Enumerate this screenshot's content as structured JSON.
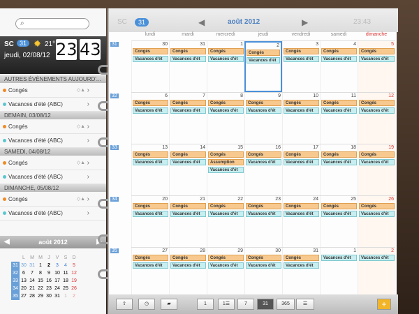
{
  "search": {
    "placeholder": ""
  },
  "header": {
    "city": "SC",
    "week": "31",
    "temp": "21°",
    "date": "jeudi, 02/08/12",
    "hour": "23",
    "minute": "43"
  },
  "sections": [
    {
      "title": "AUTRES ÉVÈNEMENTS AUJOURD'...",
      "events": [
        {
          "label": "Congés",
          "color": "#f08a24"
        },
        {
          "label": "Vacances d'été (ABC)",
          "color": "#5cc6d0"
        }
      ]
    },
    {
      "title": "DEMAIN, 03/08/12",
      "events": [
        {
          "label": "Congés",
          "color": "#f08a24"
        },
        {
          "label": "Vacances d'été (ABC)",
          "color": "#5cc6d0"
        }
      ]
    },
    {
      "title": "SAMEDI, 04/08/12",
      "events": [
        {
          "label": "Congés",
          "color": "#f08a24"
        },
        {
          "label": "Vacances d'été (ABC)",
          "color": "#5cc6d0"
        }
      ]
    },
    {
      "title": "DIMANCHE, 05/08/12",
      "events": [
        {
          "label": "Congés",
          "color": "#f08a24"
        },
        {
          "label": "Vacances d'été (ABC)",
          "color": "#5cc6d0"
        }
      ]
    }
  ],
  "mini": {
    "title": "août 2012",
    "headers": [
      "L",
      "M",
      "M",
      "J",
      "V",
      "S",
      "D"
    ],
    "weeks": [
      {
        "wn": "31",
        "days": [
          "30",
          "31",
          "1",
          "2",
          "3",
          "4",
          "5"
        ]
      },
      {
        "wn": "32",
        "days": [
          "6",
          "7",
          "8",
          "9",
          "10",
          "11",
          "12"
        ]
      },
      {
        "wn": "33",
        "days": [
          "13",
          "14",
          "15",
          "16",
          "17",
          "18",
          "19"
        ]
      },
      {
        "wn": "34",
        "days": [
          "20",
          "21",
          "22",
          "23",
          "24",
          "25",
          "26"
        ]
      },
      {
        "wn": "35",
        "days": [
          "27",
          "28",
          "29",
          "30",
          "31",
          "1",
          "2"
        ]
      }
    ]
  },
  "top": {
    "left_ghost": "SC",
    "week": "31",
    "title": "août 2012",
    "right_ghost": "23:43"
  },
  "day_headers": [
    "lundi",
    "mardi",
    "mercredi",
    "jeudi",
    "vendredi",
    "samedi",
    "dimanche"
  ],
  "weeks": [
    {
      "wn": "31",
      "days": [
        "30",
        "31",
        "1",
        "2",
        "3",
        "4",
        "5"
      ]
    },
    {
      "wn": "32",
      "days": [
        "6",
        "7",
        "8",
        "9",
        "10",
        "11",
        "12"
      ]
    },
    {
      "wn": "33",
      "days": [
        "13",
        "14",
        "15",
        "16",
        "17",
        "18",
        "19"
      ]
    },
    {
      "wn": "34",
      "days": [
        "20",
        "21",
        "22",
        "23",
        "24",
        "25",
        "26"
      ]
    },
    {
      "wn": "35",
      "days": [
        "27",
        "28",
        "29",
        "30",
        "31",
        "1",
        "2"
      ]
    }
  ],
  "events": {
    "conges": "Congés",
    "vacances": "Vacances d'ét",
    "assumption": "Assumption"
  },
  "bottom": {
    "one": "1",
    "list": "1☰",
    "seven": "7",
    "thirtyone": "31",
    "year": "365"
  },
  "colors": {
    "accent": "#4a90d9",
    "conges": "#f7c98f",
    "vacances": "#c7eef0"
  }
}
